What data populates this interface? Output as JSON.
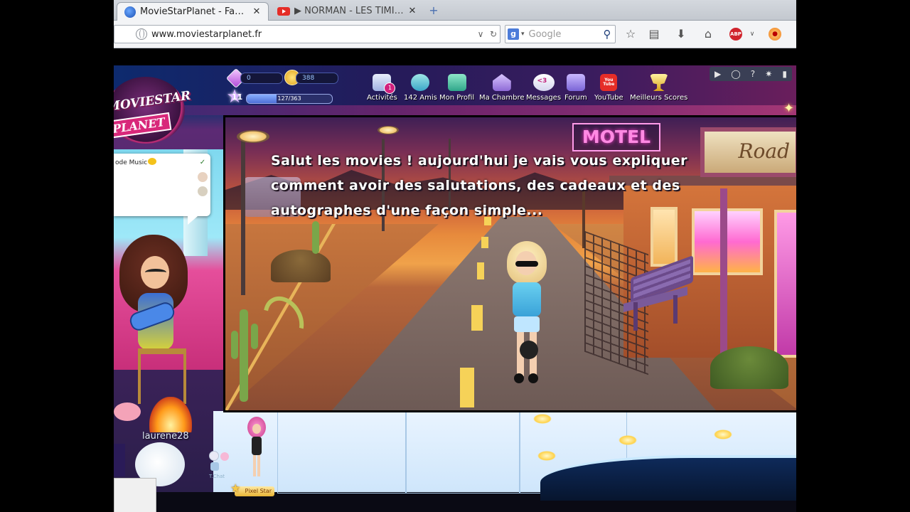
{
  "browser": {
    "tabs": [
      {
        "title": "MovieStarPlanet - Fa…",
        "close": "✕"
      },
      {
        "title": "▶ NORMAN - LES TIMI…",
        "close": "✕"
      }
    ],
    "newtab_symbol": "+",
    "url": "www.moviestarplanet.fr",
    "url_dropdown": "∨",
    "reload": "↻",
    "search_engine": "g",
    "search_dropdown": "▾",
    "search_placeholder": "Google",
    "search_button": "⚲",
    "toolbar": {
      "bookmark_star": "☆",
      "reader": "▤",
      "download": "⬇",
      "home": "⌂",
      "adblock": "ABP",
      "adblock_dropdown": "∨",
      "extension": "●"
    }
  },
  "game": {
    "logo": {
      "line1": "MOVIESTAR",
      "line2": "PLANET"
    },
    "diamonds": "0",
    "coins": "388",
    "level": "11",
    "xp": "127/363",
    "xp_fraction": 0.35,
    "nav": [
      {
        "label": "Activités",
        "icon": "clipboard-icon",
        "badge": "1"
      },
      {
        "label": "142 Amis",
        "icon": "friends-icon"
      },
      {
        "label": "Mon Profil",
        "icon": "profile-book-icon"
      },
      {
        "label": "Ma Chambre",
        "icon": "house-icon"
      },
      {
        "label": "Messages",
        "icon": "messages-icon",
        "badge": "<3"
      },
      {
        "label": "Forum",
        "icon": "forum-icon"
      },
      {
        "label": "YouTube",
        "icon": "youtube-icon",
        "badge": "You Tube"
      },
      {
        "label": "Meilleurs Scores",
        "icon": "trophy-icon"
      }
    ],
    "topright_controls": [
      "▶",
      "◯",
      "?",
      "✷",
      "▮"
    ],
    "chat": {
      "text": "ode Music"
    },
    "player_name": "laurene28",
    "bottom": {
      "chat_label": "T.Chat",
      "pixel_star": "Pixel Star"
    }
  },
  "scene": {
    "motel_sign": "MOTEL",
    "road_sign": "Road",
    "caption_lines": [
      "Salut les movies ! aujourd'hui je vais vous expliquer",
      "comment avoir des salutations, des cadeaux et des",
      "autographes d'une façon simple..."
    ]
  },
  "colors": {
    "accent_pink": "#d8287a",
    "sky_orange": "#e78a3c",
    "nav_bg": "#241b5a"
  }
}
